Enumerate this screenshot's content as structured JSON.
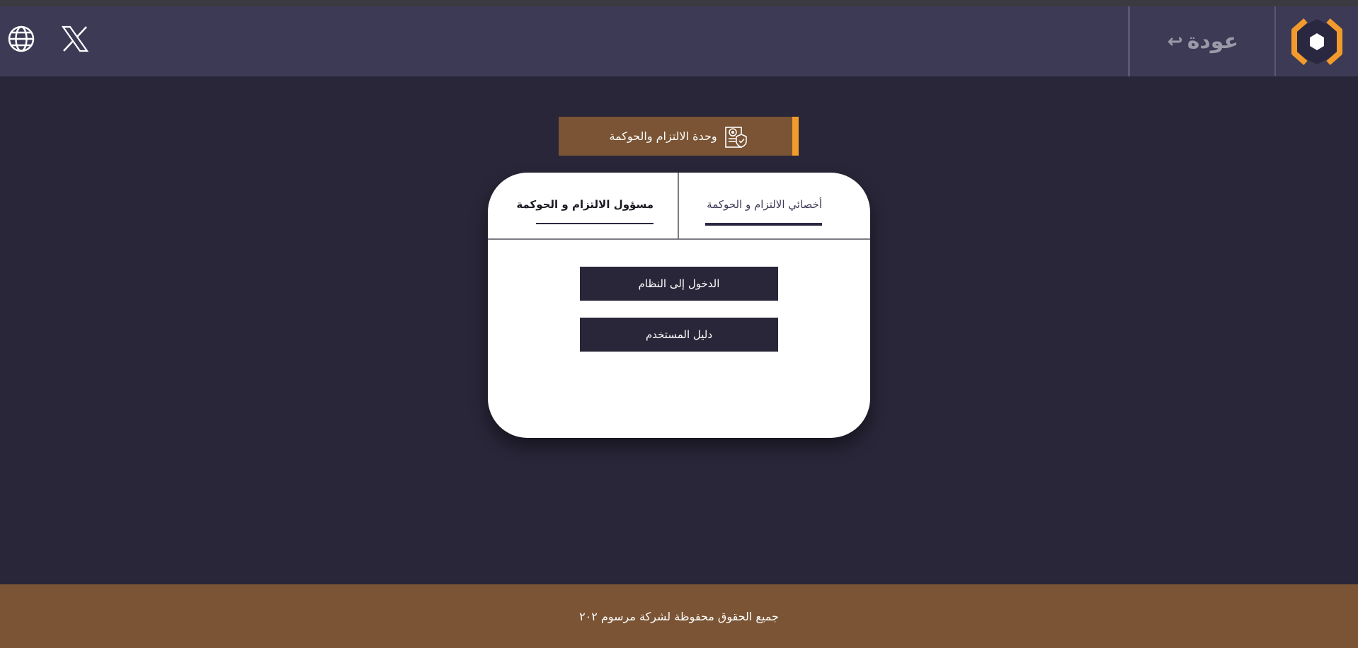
{
  "header": {
    "back_label": "عودة",
    "back_arrow": "↩",
    "icons": [
      "globe-icon",
      "x-logo-icon",
      "app-logo-icon"
    ],
    "logo_colors": {
      "outer": "#f29b2c",
      "inner": "#2a2840"
    }
  },
  "unit": {
    "title": "وحدة الالتزام والحوكمة",
    "icon": "document-badge-icon",
    "accent_color": "#f29b2c",
    "background_color": "#7a5434"
  },
  "tabs": [
    {
      "label": "أخصائي الالتزام و الحوكمة",
      "selected": true
    },
    {
      "label": "مسؤول الالتزام و الحوكمة",
      "selected": false
    }
  ],
  "buttons": {
    "login": "الدخول إلى النظام",
    "guide": "دليل المستخدم"
  },
  "footer": {
    "text": "جميع الحقوق محفوظة لشركة مرسوم ٢٠٢"
  },
  "colors": {
    "page_bg": "#282638",
    "header_bg": "#3c3a55",
    "button_bg": "#282638"
  }
}
